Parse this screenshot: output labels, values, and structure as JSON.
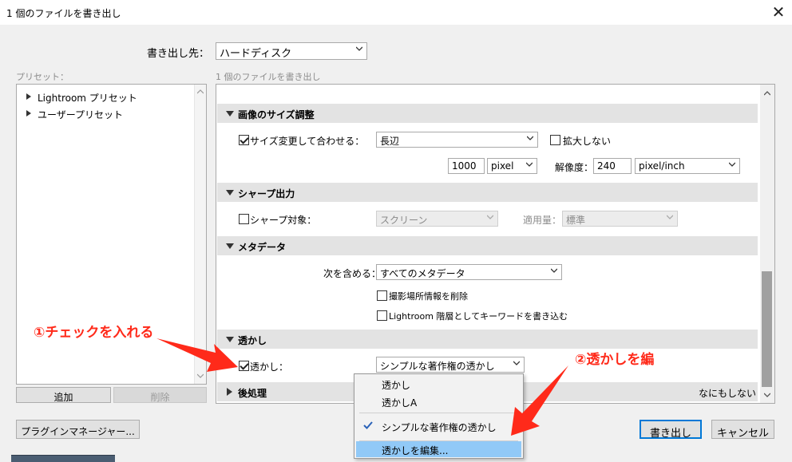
{
  "titlebar": {
    "title": "1 個のファイルを書き出し",
    "close_glyph": "✕"
  },
  "export_to": {
    "label": "書き出し先：",
    "value": "ハードディスク"
  },
  "preset_panel": {
    "header": "プリセット：",
    "items": [
      "Lightroom プリセット",
      "ユーザープリセット"
    ],
    "add_label": "追加",
    "remove_label": "削除"
  },
  "settings_header": "1 個のファイルを書き出し",
  "sections": {
    "image_sizing": {
      "title": "画像のサイズ調整",
      "resize_label": "サイズ変更して合わせる：",
      "resize_checked": true,
      "resize_mode": "長辺",
      "dont_enlarge_label": "拡大しない",
      "dont_enlarge_checked": false,
      "size_value": "1000",
      "size_unit": "pixel",
      "resolution_label": "解像度：",
      "resolution_value": "240",
      "resolution_unit": "pixel/inch"
    },
    "sharpening": {
      "title": "シャープ出力",
      "sharpen_label": "シャープ対象：",
      "sharpen_checked": false,
      "sharpen_for": "スクリーン",
      "amount_label": "適用量：",
      "amount_value": "標準"
    },
    "metadata": {
      "title": "メタデータ",
      "include_label": "次を含める：",
      "include_value": "すべてのメタデータ",
      "remove_location_label": "撮影場所情報を削除",
      "keywords_hierarchy_label": "Lightroom 階層としてキーワードを書き込む"
    },
    "watermark": {
      "title": "透かし",
      "watermark_label": "透かし：",
      "watermark_checked": true,
      "watermark_value": "シンプルな著作権の透かし"
    },
    "post_processing": {
      "title": "後処理",
      "value": "なにもしない"
    }
  },
  "dropdown_menu": {
    "items": [
      "透かし",
      "透かしA",
      "シンプルな著作権の透かし",
      "透かしを編集..."
    ],
    "checked_index": 2,
    "highlighted_index": 3
  },
  "footer": {
    "plugin_manager_label": "プラグインマネージャー...",
    "export_label": "書き出し",
    "cancel_label": "キャンセル"
  },
  "annotations": {
    "step1": "①チェックを入れる",
    "step2": "②透かしを編"
  },
  "colors": {
    "annotation_red": "#ff2a1a",
    "menu_highlight": "#91c9f7",
    "check_blue": "#2a62b8",
    "default_button_border": "#0078d7"
  }
}
